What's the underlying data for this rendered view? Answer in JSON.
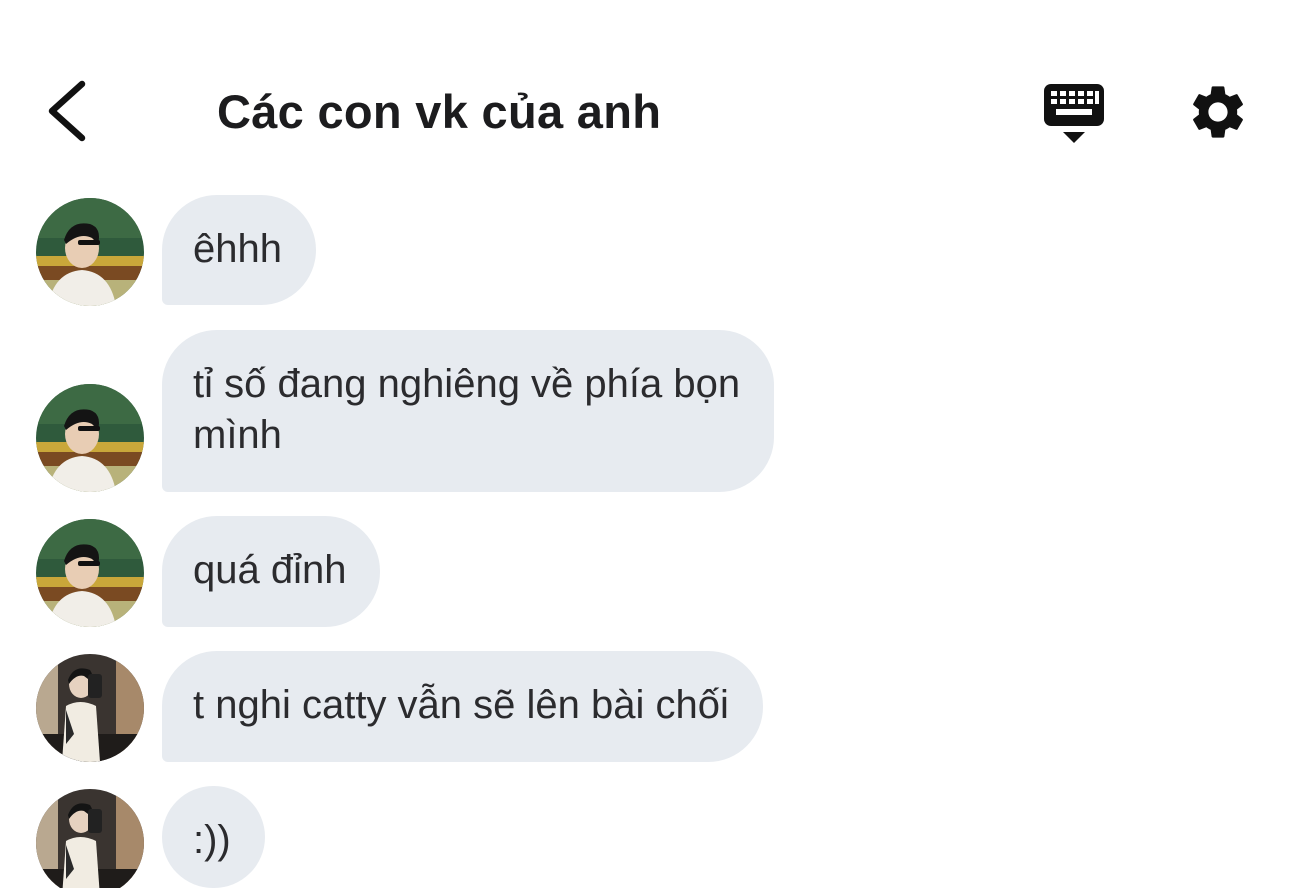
{
  "header": {
    "title": "Các con vk của anh",
    "back_icon": "chevron-left-icon",
    "keyboard_icon": "keyboard-icon",
    "settings_icon": "gear-icon"
  },
  "colors": {
    "bubble_bg": "#e7ebf0",
    "text": "#1c1c1e",
    "background": "#ffffff"
  },
  "messages": [
    {
      "sender_avatar": "avatar-1",
      "lines": [
        "êhhh"
      ]
    },
    {
      "sender_avatar": "avatar-1",
      "lines": [
        "tỉ số đang nghiêng về phía bọn",
        "mình"
      ]
    },
    {
      "sender_avatar": "avatar-1",
      "lines": [
        "quá đỉnh"
      ]
    },
    {
      "sender_avatar": "avatar-2",
      "lines": [
        "t nghi catty vẫn sẽ lên bài chối"
      ]
    },
    {
      "sender_avatar": "avatar-2",
      "lines": [
        ":))"
      ]
    }
  ]
}
